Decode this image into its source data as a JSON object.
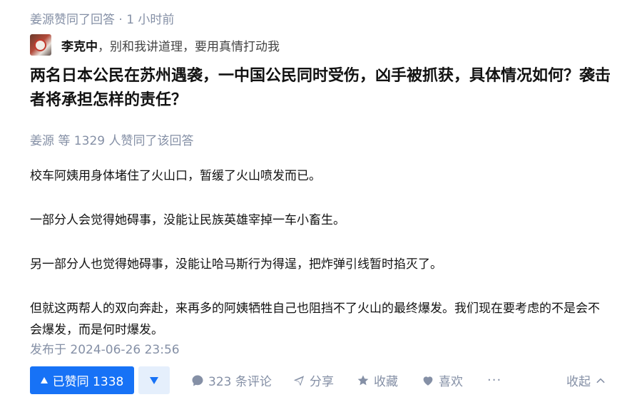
{
  "activity": {
    "text": "姜源赞同了回答 · 1 小时前"
  },
  "author": {
    "name": "李克中",
    "separator": "，",
    "bio": "别和我讲道理，要用真情打动我"
  },
  "question": {
    "title": "两名日本公民在苏州遇袭，一中国公民同时受伤，凶手被抓获，具体情况如何？袭击者将承担怎样的责任？"
  },
  "voters": {
    "text": "姜源 等 1329 人赞同了该回答"
  },
  "content": {
    "paragraphs": [
      "校车阿姨用身体堵住了火山口，暂缓了火山喷发而已。",
      "一部分人会觉得她碍事，没能让民族英雄宰掉一车小畜生。",
      "另一部分人也觉得她碍事，没能让哈马斯行为得逞，把炸弹引线暂时掐灭了。",
      "但就这两帮人的双向奔赴，来再多的阿姨牺牲自己也阻挡不了火山的最终爆发。我们现在要考虑的不是会不会爆发，而是何时爆发。"
    ]
  },
  "published": {
    "text": "发布于 2024-06-26 23:56"
  },
  "actions": {
    "vote_up_label": "已赞同 1338",
    "comment_label": "323 条评论",
    "share_label": "分享",
    "favorite_label": "收藏",
    "like_label": "喜欢",
    "more_label": "···",
    "collapse_label": "收起"
  },
  "colors": {
    "accent": "#1772f6",
    "accent_light": "#e5effc",
    "meta_gray": "#8590a6",
    "text": "#121212"
  },
  "icons": {
    "vote_up": "triangle-up-icon",
    "vote_down": "triangle-down-icon",
    "comment": "comment-bubble-icon",
    "share": "paper-plane-icon",
    "favorite": "star-icon",
    "like": "heart-icon",
    "collapse": "chevron-up-icon"
  }
}
